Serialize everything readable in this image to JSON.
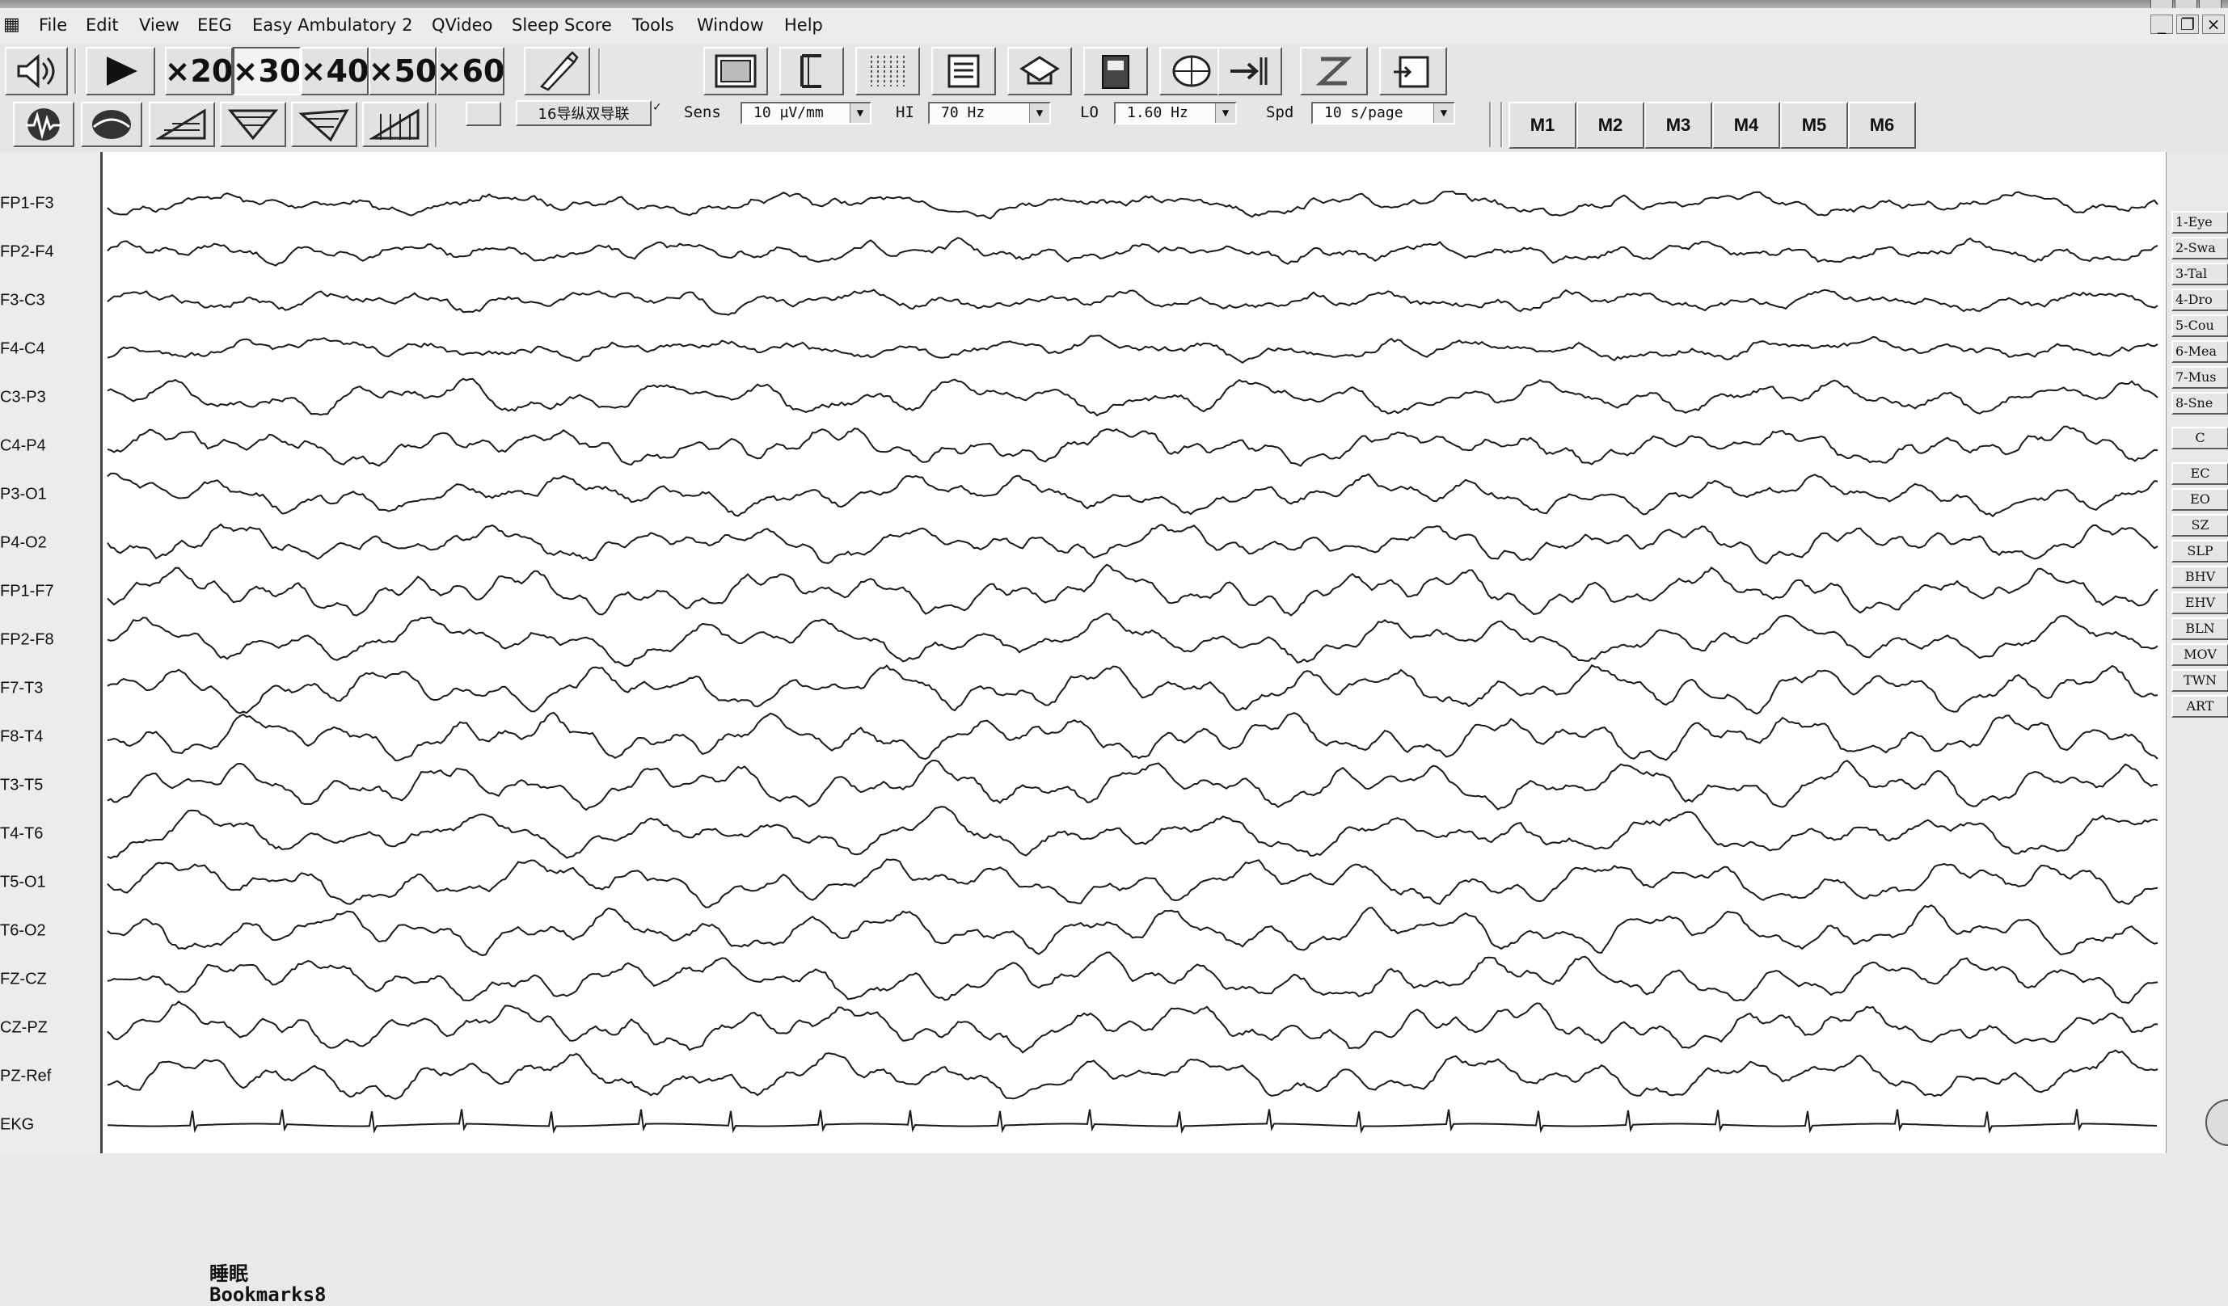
{
  "menu": {
    "items": [
      "File",
      "Edit",
      "View",
      "EEG",
      "Easy Ambulatory 2",
      "QVideo",
      "Sleep Score",
      "Tools",
      "Window",
      "Help"
    ]
  },
  "toolbar1": {
    "zoom_buttons": [
      "×20",
      "×30",
      "×40",
      "×50",
      "×60"
    ],
    "selected_zoom": "×30"
  },
  "toolbar2": {
    "montage": "16导纵双导联",
    "sens_label": "Sens",
    "sens_value": "10 µV/mm",
    "hi_label": "HI",
    "hi_value": "70 Hz",
    "lo_label": "LO",
    "lo_value": "1.60 Hz",
    "spd_label": "Spd",
    "spd_value": "10 s/page",
    "marker_buttons": [
      "M1",
      "M2",
      "M3",
      "M4",
      "M5",
      "M6"
    ]
  },
  "channels": [
    "FP1-F3",
    "FP2-F4",
    "F3-C3",
    "F4-C4",
    "C3-P3",
    "C4-P4",
    "P3-O1",
    "P4-O2",
    "FP1-F7",
    "FP2-F8",
    "F7-T3",
    "F8-T4",
    "T3-T5",
    "T4-T6",
    "T5-O1",
    "T6-O2",
    "FZ-CZ",
    "CZ-PZ",
    "PZ-Ref",
    "EKG"
  ],
  "events": [
    "1-Eye",
    "2-Swa",
    "3-Tal",
    "4-Dro",
    "5-Cou",
    "6-Mea",
    "7-Mus",
    "8-Sne"
  ],
  "c_button": "C",
  "state_buttons": [
    "EC",
    "EO",
    "SZ",
    "SLP",
    "BHV",
    "EHV",
    "BLN",
    "MOV",
    "TWN",
    "ART"
  ],
  "annotation": "睡眠",
  "bookmarks": "Bookmarks8"
}
